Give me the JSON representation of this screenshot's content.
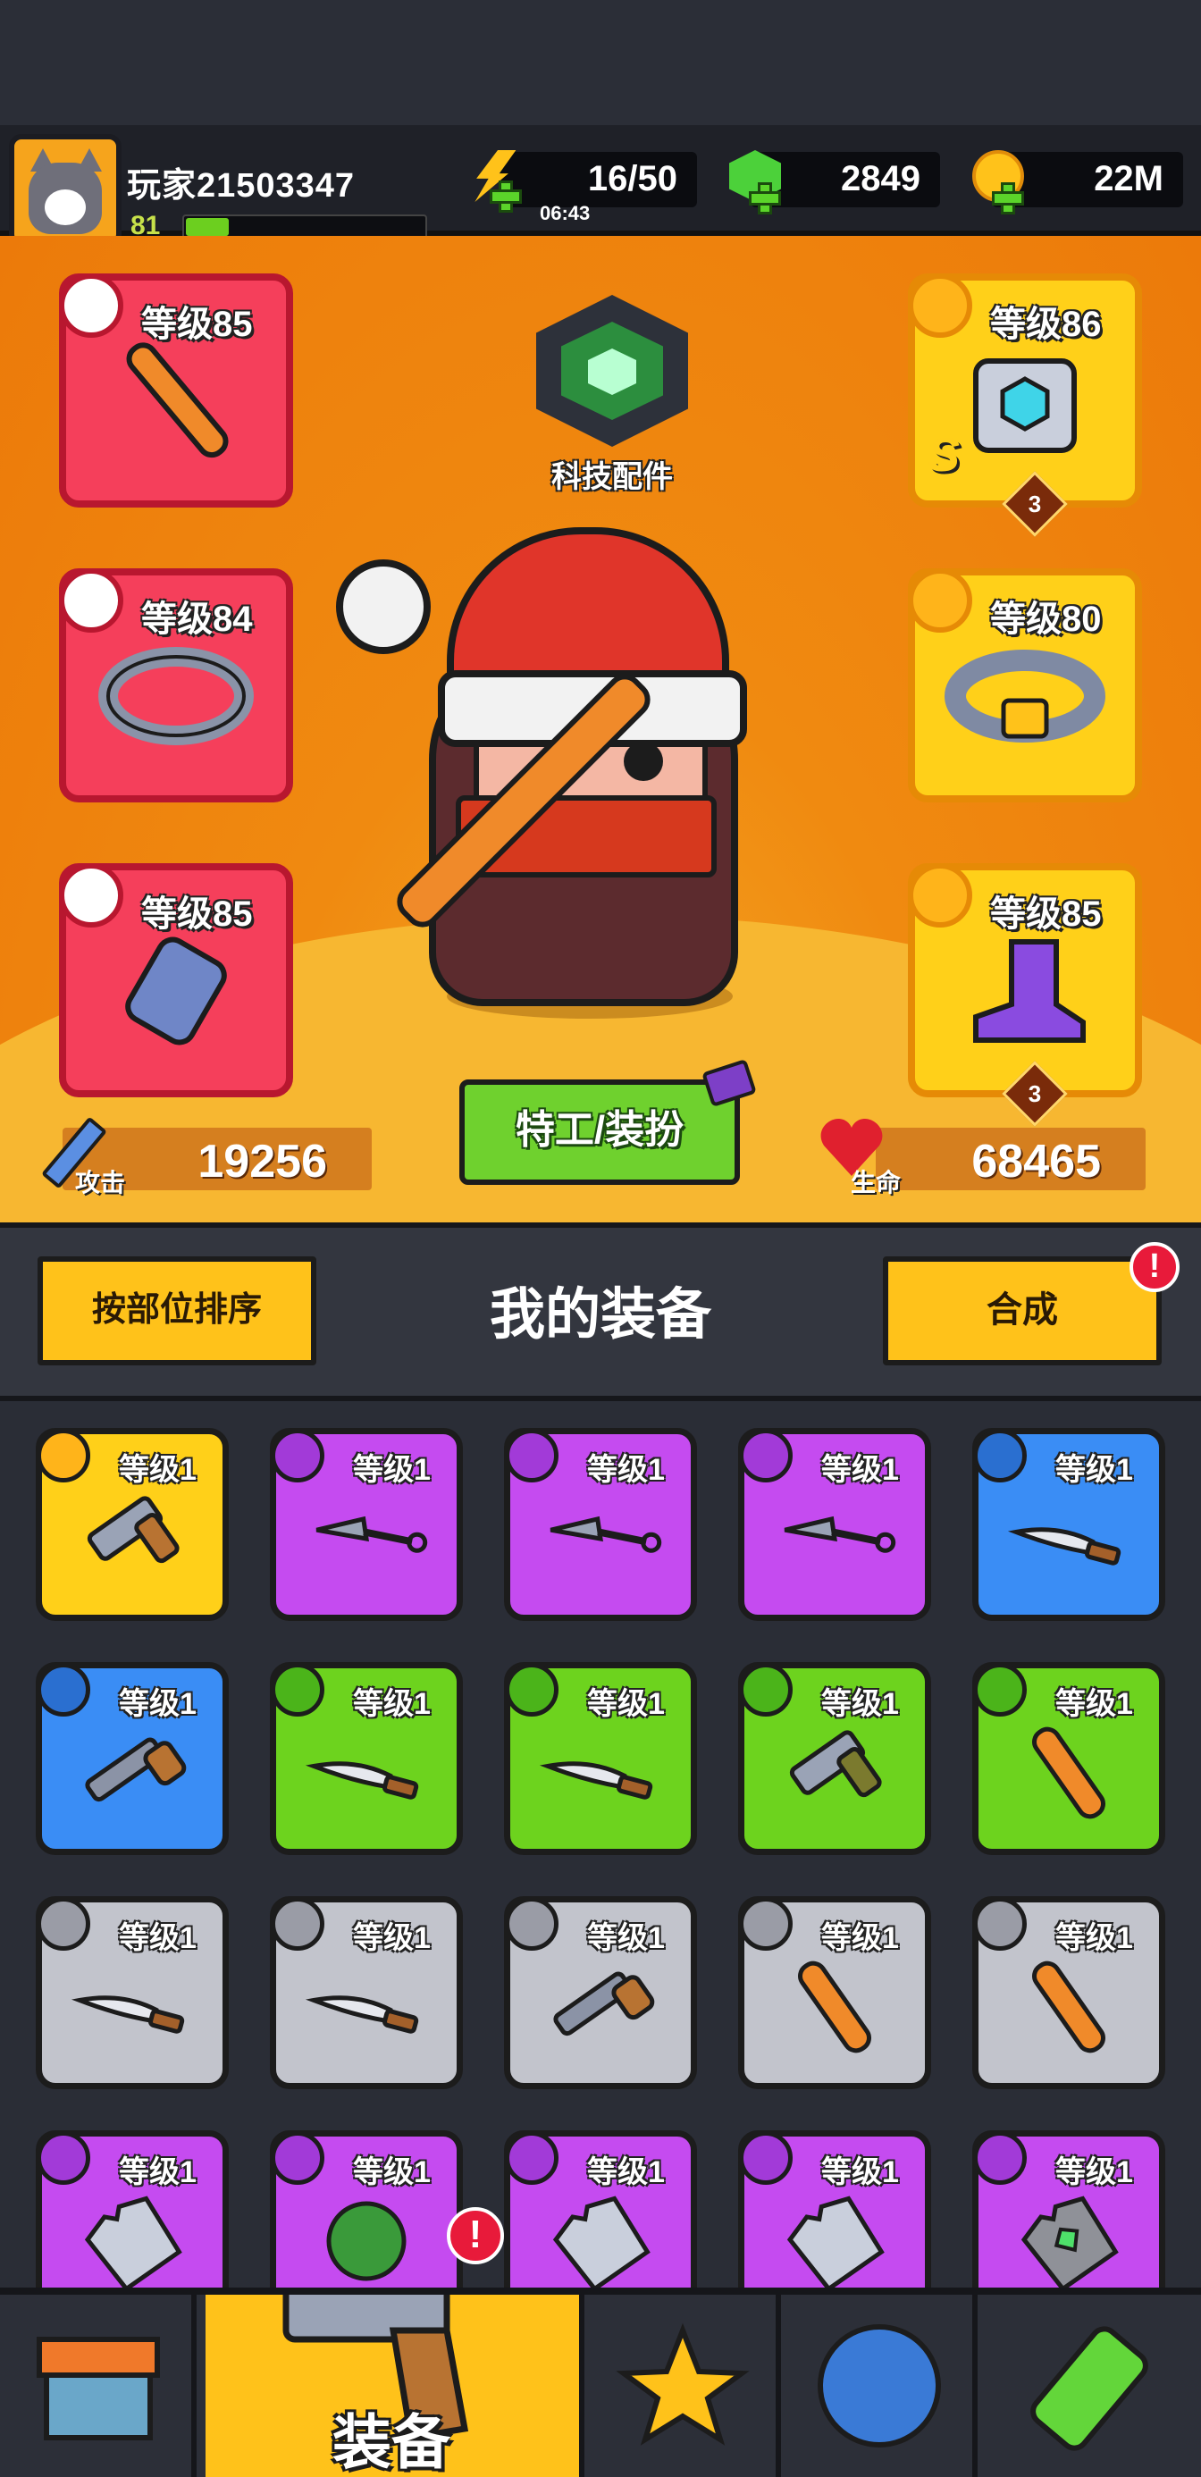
{
  "header": {
    "player_name": "玩家21503347",
    "player_level": "81",
    "xp_progress": 0.18,
    "energy": "16/50",
    "energy_timer": "06:43",
    "gems": "2849",
    "coins": "22M"
  },
  "slots": {
    "weapon": {
      "label": "等级85"
    },
    "necklace": {
      "label": "等级84"
    },
    "gloves": {
      "label": "等级85"
    },
    "armor": {
      "label": "等级86",
      "stars": "3",
      "rank": "S"
    },
    "belt": {
      "label": "等级80"
    },
    "boots": {
      "label": "等级85",
      "stars": "3"
    }
  },
  "tech": {
    "label": "科技配件"
  },
  "action_button": "特工/装扮",
  "stats": {
    "attack_label": "攻击",
    "attack_value": "19256",
    "hp_label": "生命",
    "hp_value": "68465"
  },
  "equipment": {
    "sort_label": "按部位排序",
    "title": "我的装备",
    "merge_label": "合成",
    "merge_alert": "!",
    "items": [
      {
        "rarity": "yellow",
        "icon": "gun-icon",
        "level": "等级1"
      },
      {
        "rarity": "purple",
        "icon": "kunai-icon",
        "level": "等级1"
      },
      {
        "rarity": "purple",
        "icon": "kunai-icon",
        "level": "等级1"
      },
      {
        "rarity": "purple",
        "icon": "kunai-icon",
        "level": "等级1"
      },
      {
        "rarity": "blue",
        "icon": "machete-icon",
        "level": "等级1"
      },
      {
        "rarity": "blue",
        "icon": "shotgun-icon",
        "level": "等级1"
      },
      {
        "rarity": "green",
        "icon": "machete-icon",
        "level": "等级1"
      },
      {
        "rarity": "green",
        "icon": "machete-icon",
        "level": "等级1"
      },
      {
        "rarity": "green",
        "icon": "revolver-icon",
        "level": "等级1"
      },
      {
        "rarity": "green",
        "icon": "bat-icon",
        "level": "等级1"
      },
      {
        "rarity": "grey",
        "icon": "machete-icon",
        "level": "等级1"
      },
      {
        "rarity": "grey",
        "icon": "machete-icon",
        "level": "等级1"
      },
      {
        "rarity": "grey",
        "icon": "shotgun-icon",
        "level": "等级1"
      },
      {
        "rarity": "grey",
        "icon": "bat-icon",
        "level": "等级1"
      },
      {
        "rarity": "grey",
        "icon": "bat-icon",
        "level": "等级1"
      },
      {
        "rarity": "purple",
        "icon": "armor-icon",
        "level": "等级1"
      },
      {
        "rarity": "purple",
        "icon": "plant-armor-icon",
        "level": "等级1"
      },
      {
        "rarity": "purple",
        "icon": "armor-icon",
        "level": "等级1"
      },
      {
        "rarity": "purple",
        "icon": "armor-icon",
        "level": "等级1"
      },
      {
        "rarity": "purple",
        "icon": "gem-armor-icon",
        "level": "等级1"
      }
    ]
  },
  "nav": {
    "active_label": "装备",
    "alert": "!",
    "tabs": [
      "shop-icon",
      "equipment-icon",
      "star-swords-icon",
      "star-orb-icon",
      "dna-vial-icon"
    ]
  },
  "colors": {
    "yellow": "#ffd019",
    "purple": "#c54bf0",
    "blue": "#3a8df5",
    "green": "#6dd31e",
    "grey": "#c2c4cc",
    "accent": "#ffc21a"
  }
}
